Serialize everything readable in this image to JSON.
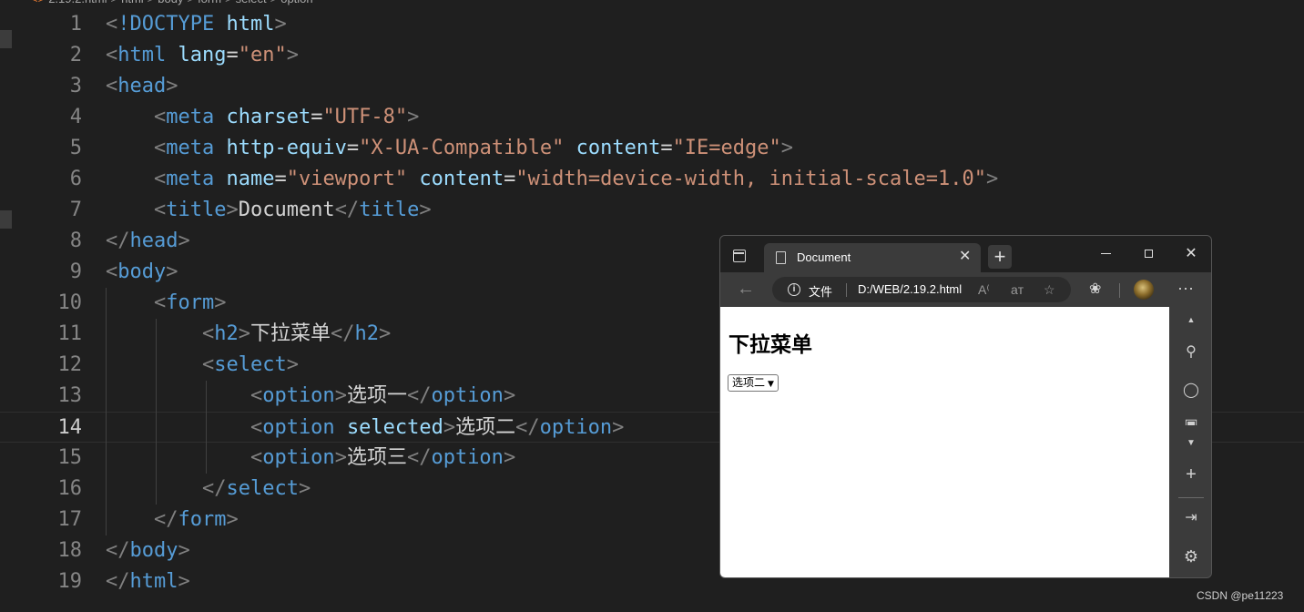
{
  "breadcrumb": [
    "2.19.2.html",
    "html",
    "body",
    "form",
    "select",
    "option"
  ],
  "code_lines": [
    {
      "n": "1",
      "tokens": [
        [
          "br",
          "<"
        ],
        [
          "tag",
          "!DOCTYPE"
        ],
        [
          "txt",
          " "
        ],
        [
          "attr",
          "html"
        ],
        [
          "br",
          ">"
        ]
      ]
    },
    {
      "n": "2",
      "tokens": [
        [
          "br",
          "<"
        ],
        [
          "tag",
          "html"
        ],
        [
          "txt",
          " "
        ],
        [
          "attr",
          "lang"
        ],
        [
          "txt",
          "="
        ],
        [
          "str",
          "\"en\""
        ],
        [
          "br",
          ">"
        ]
      ]
    },
    {
      "n": "3",
      "tokens": [
        [
          "br",
          "<"
        ],
        [
          "tag",
          "head"
        ],
        [
          "br",
          ">"
        ]
      ]
    },
    {
      "n": "4",
      "tokens": [
        [
          "txt",
          "    "
        ],
        [
          "br",
          "<"
        ],
        [
          "tag",
          "meta"
        ],
        [
          "txt",
          " "
        ],
        [
          "attr",
          "charset"
        ],
        [
          "txt",
          "="
        ],
        [
          "str",
          "\"UTF-8\""
        ],
        [
          "br",
          ">"
        ]
      ]
    },
    {
      "n": "5",
      "tokens": [
        [
          "txt",
          "    "
        ],
        [
          "br",
          "<"
        ],
        [
          "tag",
          "meta"
        ],
        [
          "txt",
          " "
        ],
        [
          "attr",
          "http-equiv"
        ],
        [
          "txt",
          "="
        ],
        [
          "str",
          "\"X-UA-Compatible\""
        ],
        [
          "txt",
          " "
        ],
        [
          "attr",
          "content"
        ],
        [
          "txt",
          "="
        ],
        [
          "str",
          "\"IE=edge\""
        ],
        [
          "br",
          ">"
        ]
      ]
    },
    {
      "n": "6",
      "tokens": [
        [
          "txt",
          "    "
        ],
        [
          "br",
          "<"
        ],
        [
          "tag",
          "meta"
        ],
        [
          "txt",
          " "
        ],
        [
          "attr",
          "name"
        ],
        [
          "txt",
          "="
        ],
        [
          "str",
          "\"viewport\""
        ],
        [
          "txt",
          " "
        ],
        [
          "attr",
          "content"
        ],
        [
          "txt",
          "="
        ],
        [
          "str",
          "\"width=device-width, initial-scale=1.0\""
        ],
        [
          "br",
          ">"
        ]
      ]
    },
    {
      "n": "7",
      "tokens": [
        [
          "txt",
          "    "
        ],
        [
          "br",
          "<"
        ],
        [
          "tag",
          "title"
        ],
        [
          "br",
          ">"
        ],
        [
          "txt",
          "Document"
        ],
        [
          "br",
          "</"
        ],
        [
          "tag",
          "title"
        ],
        [
          "br",
          ">"
        ]
      ]
    },
    {
      "n": "8",
      "tokens": [
        [
          "br",
          "</"
        ],
        [
          "tag",
          "head"
        ],
        [
          "br",
          ">"
        ]
      ]
    },
    {
      "n": "9",
      "tokens": [
        [
          "br",
          "<"
        ],
        [
          "tag",
          "body"
        ],
        [
          "br",
          ">"
        ]
      ]
    },
    {
      "n": "10",
      "tokens": [
        [
          "txt",
          "    "
        ],
        [
          "br",
          "<"
        ],
        [
          "tag",
          "form"
        ],
        [
          "br",
          ">"
        ]
      ]
    },
    {
      "n": "11",
      "tokens": [
        [
          "txt",
          "        "
        ],
        [
          "br",
          "<"
        ],
        [
          "tag",
          "h2"
        ],
        [
          "br",
          ">"
        ],
        [
          "txt",
          "下拉菜单"
        ],
        [
          "br",
          "</"
        ],
        [
          "tag",
          "h2"
        ],
        [
          "br",
          ">"
        ]
      ]
    },
    {
      "n": "12",
      "tokens": [
        [
          "txt",
          "        "
        ],
        [
          "br",
          "<"
        ],
        [
          "tag",
          "select"
        ],
        [
          "br",
          ">"
        ]
      ]
    },
    {
      "n": "13",
      "tokens": [
        [
          "txt",
          "            "
        ],
        [
          "br",
          "<"
        ],
        [
          "tag",
          "option"
        ],
        [
          "br",
          ">"
        ],
        [
          "txt",
          "选项一"
        ],
        [
          "br",
          "</"
        ],
        [
          "tag",
          "option"
        ],
        [
          "br",
          ">"
        ]
      ]
    },
    {
      "n": "14",
      "tokens": [
        [
          "txt",
          "            "
        ],
        [
          "br",
          "<"
        ],
        [
          "tag",
          "option"
        ],
        [
          "txt",
          " "
        ],
        [
          "attr",
          "selected"
        ],
        [
          "br",
          ">"
        ],
        [
          "txt",
          "选项二"
        ],
        [
          "br",
          "</"
        ],
        [
          "tag",
          "option"
        ],
        [
          "br",
          ">"
        ]
      ]
    },
    {
      "n": "15",
      "tokens": [
        [
          "txt",
          "            "
        ],
        [
          "br",
          "<"
        ],
        [
          "tag",
          "option"
        ],
        [
          "br",
          ">"
        ],
        [
          "txt",
          "选项三"
        ],
        [
          "br",
          "</"
        ],
        [
          "tag",
          "option"
        ],
        [
          "br",
          ">"
        ]
      ]
    },
    {
      "n": "16",
      "tokens": [
        [
          "txt",
          "        "
        ],
        [
          "br",
          "</"
        ],
        [
          "tag",
          "select"
        ],
        [
          "br",
          ">"
        ]
      ]
    },
    {
      "n": "17",
      "tokens": [
        [
          "txt",
          "    "
        ],
        [
          "br",
          "</"
        ],
        [
          "tag",
          "form"
        ],
        [
          "br",
          ">"
        ]
      ]
    },
    {
      "n": "18",
      "tokens": [
        [
          "br",
          "</"
        ],
        [
          "tag",
          "body"
        ],
        [
          "br",
          ">"
        ]
      ]
    },
    {
      "n": "19",
      "tokens": [
        [
          "br",
          "</"
        ],
        [
          "tag",
          "html"
        ],
        [
          "br",
          ">"
        ]
      ]
    }
  ],
  "current_line": "14",
  "colors": {
    "editor_bg": "#1f1f1f",
    "tag": "#569cd6",
    "attr": "#9cdcfe",
    "string": "#ce9178",
    "bracket": "#808080",
    "text": "#d4d4d4"
  },
  "browser": {
    "tab_title": "Document",
    "tab_close": "✕",
    "new_tab": "+",
    "close": "✕",
    "address_label": "文件",
    "url": "D:/WEB/2.19.2.html",
    "more": "···",
    "icons": [
      "tab-actions-icon",
      "document-icon",
      "back-arrow-icon",
      "info-icon",
      "read-aloud-icon",
      "translate-icon",
      "favorite-add-icon",
      "extensions-icon",
      "profile-avatar-icon",
      "more-icon",
      "minimize-icon",
      "maximize-icon",
      "close-icon",
      "search-icon",
      "tag-icon",
      "briefcase-icon",
      "plus-icon",
      "sidebar-expand-icon",
      "settings-icon"
    ]
  },
  "page": {
    "heading": "下拉菜单",
    "select_value": "选项二"
  },
  "watermark": "CSDN @pe11223"
}
